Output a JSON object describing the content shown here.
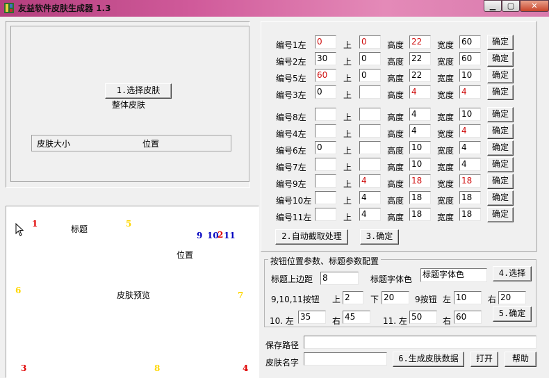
{
  "window": {
    "title": "友益软件皮肤生成器 1.3",
    "min_glyph": "▁",
    "max_glyph": "▢",
    "close_glyph": "✕"
  },
  "left": {
    "select_skin_button": "1.选择皮肤",
    "whole_skin_label": "整体皮肤",
    "size_header": "皮肤大小",
    "position_header": "位置"
  },
  "preview": {
    "title_label": "标题",
    "position_label": "位置",
    "preview_label": "皮肤预览",
    "markers": {
      "m1": "1",
      "m5": "5",
      "m9": "9",
      "m10": "10",
      "m2": "2",
      "m11": "11",
      "m6": "6",
      "m7": "7",
      "m3": "3",
      "m8": "8",
      "m4": "4"
    }
  },
  "rows": [
    {
      "label": "编号1左",
      "left": "0",
      "left_red": true,
      "top": "0",
      "top_red": true,
      "height": "22",
      "height_red": true,
      "width": "60",
      "width_red": false
    },
    {
      "label": "编号2左",
      "left": "30",
      "left_red": false,
      "top": "0",
      "top_red": false,
      "height": "22",
      "height_red": false,
      "width": "60",
      "width_red": false
    },
    {
      "label": "编号5左",
      "left": "60",
      "left_red": true,
      "top": "0",
      "top_red": false,
      "height": "22",
      "height_red": false,
      "width": "10",
      "width_red": false
    },
    {
      "label": "编号3左",
      "left": "0",
      "left_red": false,
      "top": "",
      "top_red": false,
      "height": "4",
      "height_red": true,
      "width": "4",
      "width_red": true
    },
    {
      "label": "编号8左",
      "left": "",
      "left_red": false,
      "top": "",
      "top_red": false,
      "height": "4",
      "height_red": false,
      "width": "10",
      "width_red": false
    },
    {
      "label": "编号4左",
      "left": "",
      "left_red": false,
      "top": "",
      "top_red": false,
      "height": "4",
      "height_red": false,
      "width": "4",
      "width_red": true
    },
    {
      "label": "编号6左",
      "left": "0",
      "left_red": false,
      "top": "",
      "top_red": false,
      "height": "10",
      "height_red": false,
      "width": "4",
      "width_red": false
    },
    {
      "label": "编号7左",
      "left": "",
      "left_red": false,
      "top": "",
      "top_red": false,
      "height": "10",
      "height_red": false,
      "width": "4",
      "width_red": false
    },
    {
      "label": "编号9左",
      "left": "",
      "left_red": false,
      "top": "4",
      "top_red": true,
      "height": "18",
      "height_red": true,
      "width": "18",
      "width_red": true
    },
    {
      "label": "编号10左",
      "left": "",
      "left_red": false,
      "top": "4",
      "top_red": false,
      "height": "18",
      "height_red": false,
      "width": "18",
      "width_red": false
    },
    {
      "label": "编号11左",
      "left": "",
      "left_red": false,
      "top": "4",
      "top_red": false,
      "height": "18",
      "height_red": false,
      "width": "18",
      "width_red": false
    }
  ],
  "row_text": {
    "top": "上",
    "height": "高度",
    "width": "宽度",
    "confirm": "确定"
  },
  "actions": {
    "auto_capture": "2.自动截取处理",
    "confirm3": "3.确定"
  },
  "group": {
    "title": "按钮位置参数、标题参数配置",
    "title_top_margin_label": "标题上边距",
    "title_top_margin_value": "8",
    "title_font_color_label": "标题字体色",
    "title_font_color_value": "标题字体色",
    "select_button": "4.选择",
    "btn91011_label": "9,10,11按钮",
    "up_label": "上",
    "up_value": "2",
    "down_label": "下",
    "down_value": "20",
    "btn9_label": "9按钮",
    "btn9_left_label": "左",
    "btn9_left_value": "10",
    "btn9_right_label": "右",
    "btn9_right_value": "20",
    "b10_left_label": "10. 左",
    "b10_left_value": "35",
    "b10_right_label": "右",
    "b10_right_value": "45",
    "b11_left_label": "11. 左",
    "b11_left_value": "50",
    "b11_right_label": "右",
    "b11_right_value": "60",
    "confirm5": "5.确定"
  },
  "bottom": {
    "save_path_label": "保存路径",
    "save_path_value": "",
    "skin_name_label": "皮肤名字",
    "skin_name_value": "",
    "generate_button": "6.生成皮肤数据",
    "open_button": "打开",
    "help_button": "帮助"
  },
  "colors": {
    "red_text": "#d01010",
    "marker_red": "#e00000",
    "marker_yellow": "#ffd700",
    "marker_blue": "#0000c0",
    "titlebar": "#d05a9a"
  }
}
